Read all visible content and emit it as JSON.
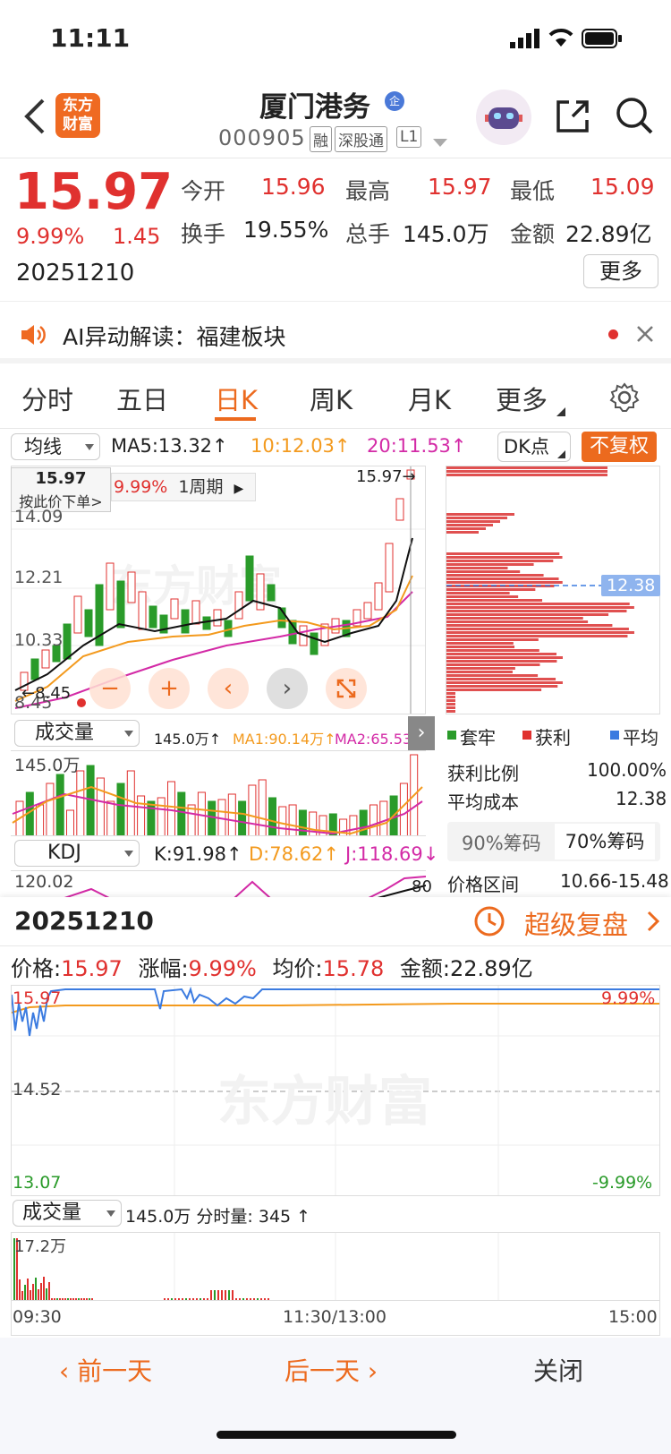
{
  "status_bar": {
    "time": "11:11"
  },
  "header": {
    "title": "厦门港务",
    "title_badge": "企",
    "code": "000905",
    "tags": [
      "融",
      "深股通",
      "L1"
    ],
    "logo_text": [
      "东方",
      "财富"
    ]
  },
  "quote": {
    "price": "15.97",
    "change_pct": "9.99%",
    "change": "1.45",
    "date": "20251210",
    "fields": [
      {
        "label": "今开",
        "value": "15.96"
      },
      {
        "label": "最高",
        "value": "15.97"
      },
      {
        "label": "最低",
        "value": "15.09"
      },
      {
        "label": "换手",
        "value": "19.55%"
      },
      {
        "label": "总手",
        "value": "145.0万"
      },
      {
        "label": "金额",
        "value": "22.89亿"
      }
    ],
    "more_label": "更多"
  },
  "ai_banner": {
    "text": "AI异动解读：福建板块"
  },
  "tabs": [
    "分时",
    "五日",
    "日K",
    "周K",
    "月K",
    "更多"
  ],
  "active_tab": "日K",
  "kline": {
    "ma_selector": "均线",
    "ma5": "MA5:13.32↑",
    "ma10": "10:12.03↑",
    "ma20": "20:11.53↑",
    "dk_label": "DK点",
    "fq_label": "不复权",
    "tooltip_price": "15.97",
    "tooltip_sub": "按此价下单>",
    "tooltip_pct": "9.99%",
    "tooltip_period": "1周期",
    "high_marker": "15.97→",
    "y_labels": [
      "14.09",
      "12.21",
      "10.33",
      "8.45"
    ],
    "low_marker": "←8.45",
    "watermark": "东方财富",
    "cost_line": "12.38"
  },
  "volume_panel": {
    "selector": "成交量",
    "vol": "145.0万↑",
    "ma1": "MA1:90.14万↑",
    "ma2": "MA2:65.53万",
    "y_top": "145.0万"
  },
  "kdj_panel": {
    "selector": "KDJ",
    "k": "K:91.98↑",
    "d": "D:78.62↑",
    "j": "J:118.69↓",
    "y_top": "120.02",
    "right_label": "80"
  },
  "chips": {
    "legend": [
      "套牢",
      "获利",
      "平均"
    ],
    "rows": [
      {
        "label": "获利比例",
        "value": "100.00%"
      },
      {
        "label": "平均成本",
        "value": "12.38"
      }
    ],
    "tab_90": "90%筹码",
    "tab_70": "70%筹码",
    "range_label": "价格区间",
    "range_value": "10.66-15.48"
  },
  "intraday": {
    "date": "20251210",
    "replay_label": "超级复盘",
    "price_label": "价格:",
    "price": "15.97",
    "chg_label": "涨幅:",
    "chg": "9.99%",
    "avg_label": "均价:",
    "avg": "15.78",
    "amt_label": "金额:",
    "amt": "22.89亿",
    "y_top": "15.97",
    "y_mid": "14.52",
    "y_bot": "13.07",
    "pct_top": "9.99%",
    "pct_bot": "-9.99%",
    "vol_selector": "成交量",
    "vol_info": "145.0万 分时量: 345 ↑",
    "vol_top": "17.2万",
    "times": [
      "09:30",
      "11:30/13:00",
      "15:00"
    ]
  },
  "bottom": {
    "prev": "前一天",
    "next": "后一天",
    "close": "关闭"
  }
}
